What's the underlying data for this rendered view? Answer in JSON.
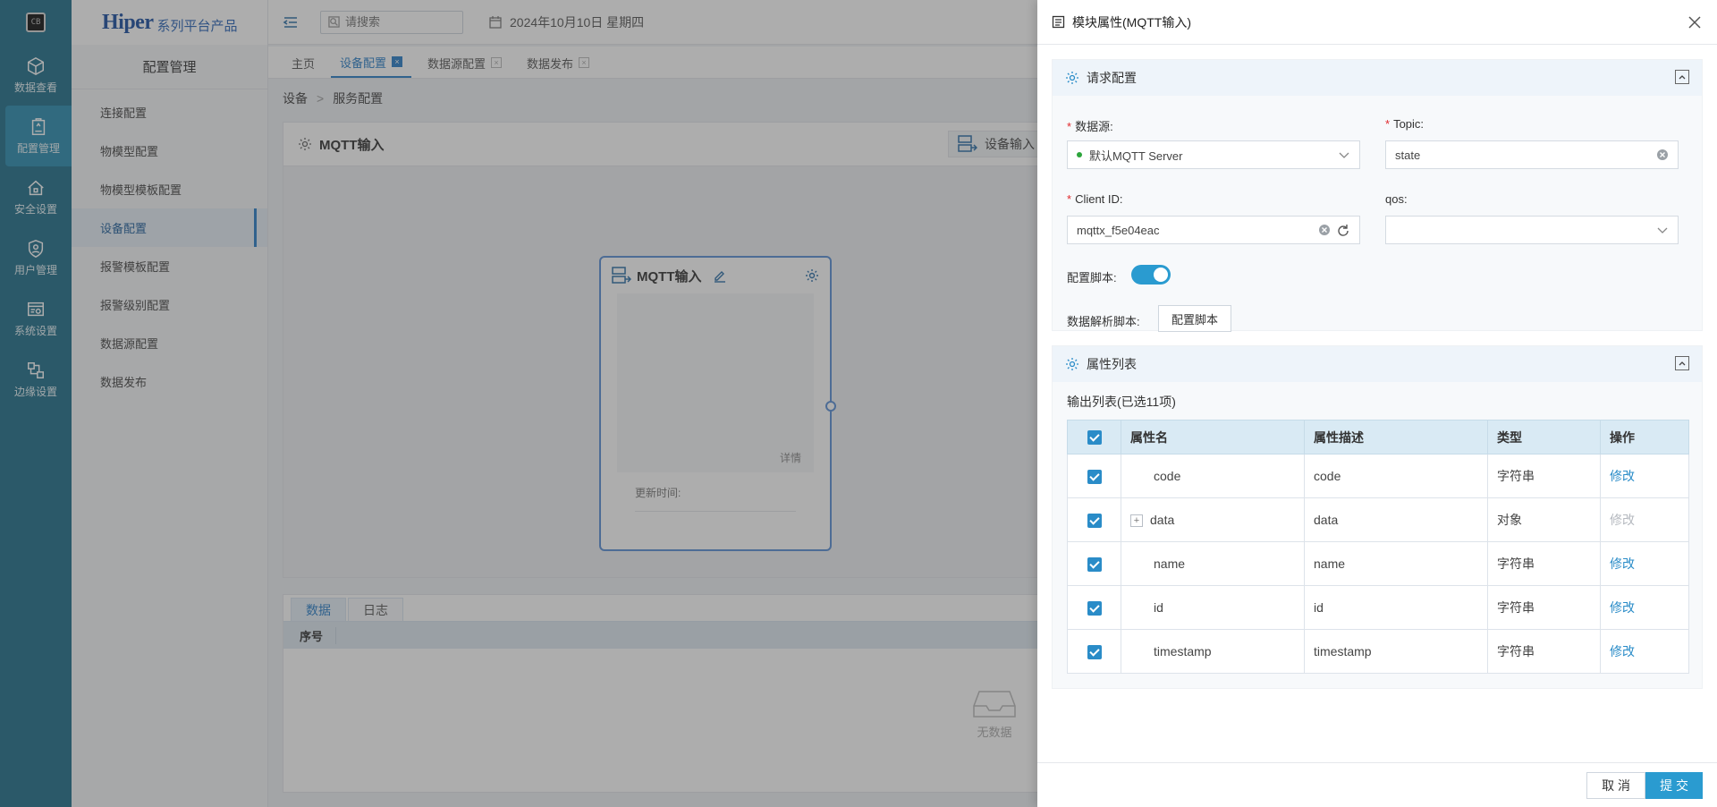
{
  "rail": {
    "items": [
      {
        "label": "数据查看",
        "icon": "cube-icon"
      },
      {
        "label": "配置管理",
        "icon": "clipboard-icon"
      },
      {
        "label": "安全设置",
        "icon": "house-lock-icon"
      },
      {
        "label": "用户管理",
        "icon": "user-shield-icon"
      },
      {
        "label": "系统设置",
        "icon": "settings-window-icon"
      },
      {
        "label": "边缘设置",
        "icon": "edge-network-icon"
      }
    ],
    "logo_text": "CB"
  },
  "brand": {
    "main": "Hiper",
    "sub": "系列平台产品"
  },
  "sidebar": {
    "title": "配置管理",
    "items": [
      "连接配置",
      "物模型配置",
      "物模型模板配置",
      "设备配置",
      "报警模板配置",
      "报警级别配置",
      "数据源配置",
      "数据发布"
    ]
  },
  "topbar": {
    "search_placeholder": "请搜索",
    "date": "2024年10月10日 星期四"
  },
  "tabs": [
    "主页",
    "设备配置",
    "数据源配置",
    "数据发布"
  ],
  "breadcrumb": [
    "设备",
    "服务配置"
  ],
  "main": {
    "title": "MQTT输入",
    "device_button": "设备输入",
    "node": {
      "title": "MQTT输入",
      "detail": "详情",
      "update_time": "更新时间:"
    },
    "bottom_tabs": [
      "数据",
      "日志"
    ],
    "bottom_header": "序号",
    "no_data": "无数据"
  },
  "drawer": {
    "title": "模块属性(MQTT输入)",
    "request": {
      "title": "请求配置",
      "datasource_label": "数据源:",
      "datasource_value": "默认MQTT Server",
      "topic_label": "Topic:",
      "topic_value": "state",
      "clientid_label": "Client ID:",
      "clientid_value": "mqttx_f5e04eac",
      "qos_label": "qos:",
      "qos_value": "",
      "script_label": "配置脚本:",
      "script_enabled": true,
      "parse_label": "数据解析脚本:",
      "parse_button": "配置脚本"
    },
    "attrs": {
      "title": "属性列表",
      "output_title": "输出列表(已选11项)",
      "columns": [
        "属性名",
        "属性描述",
        "类型",
        "操作"
      ],
      "rows": [
        {
          "name": "code",
          "desc": "code",
          "type": "字符串",
          "op": "修改",
          "expandable": false,
          "op_enabled": true
        },
        {
          "name": "data",
          "desc": "data",
          "type": "对象",
          "op": "修改",
          "expandable": true,
          "op_enabled": false
        },
        {
          "name": "name",
          "desc": "name",
          "type": "字符串",
          "op": "修改",
          "expandable": false,
          "op_enabled": true
        },
        {
          "name": "id",
          "desc": "id",
          "type": "字符串",
          "op": "修改",
          "expandable": false,
          "op_enabled": true
        },
        {
          "name": "timestamp",
          "desc": "timestamp",
          "type": "字符串",
          "op": "修改",
          "expandable": false,
          "op_enabled": true
        }
      ]
    },
    "footer": {
      "cancel": "取 消",
      "submit": "提 交"
    }
  },
  "colors": {
    "rail": "#1f6f8b",
    "accent": "#2a9bd0",
    "link": "#2a8cc8",
    "required": "#e0292d"
  }
}
